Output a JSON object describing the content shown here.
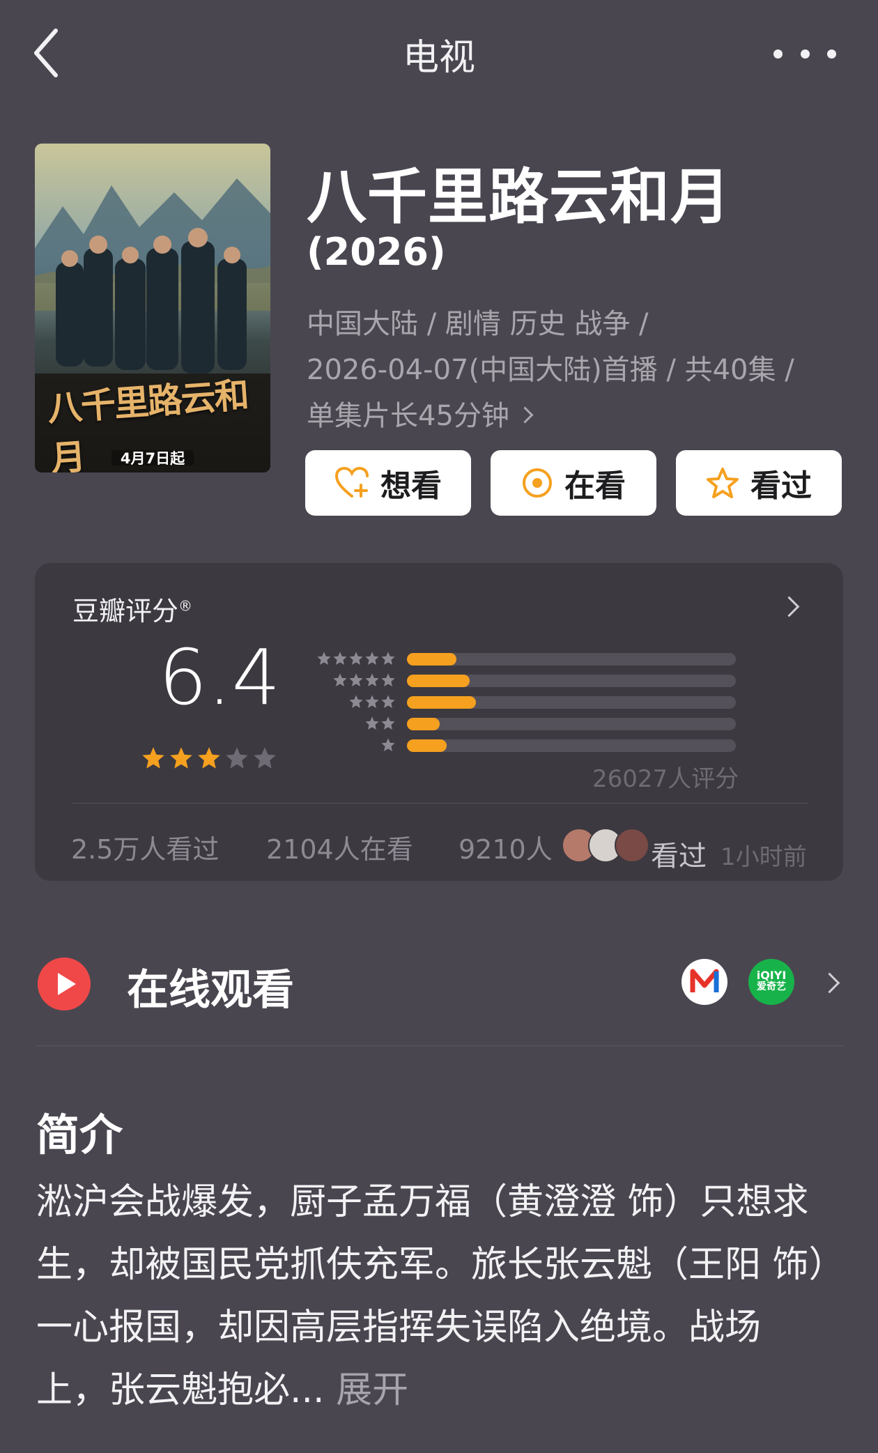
{
  "header": {
    "title": "电视",
    "back_icon": "back-arrow-icon",
    "more_icon": "more-dots-icon"
  },
  "poster": {
    "title_art": "八千里路云和月",
    "date_text": "4月7日起"
  },
  "show": {
    "title": "八千里路云和月",
    "year": "(2026)",
    "meta_line1": "中国大陆 / 剧情 历史 战争 /",
    "meta_line2": "2026-04-07(中国大陆)首播 / 共40集 /",
    "meta_line3": "单集片长45分钟"
  },
  "actions": [
    {
      "label": "想看",
      "icon": "heart-plus-icon"
    },
    {
      "label": "在看",
      "icon": "target-circle-icon"
    },
    {
      "label": "看过",
      "icon": "star-outline-icon"
    }
  ],
  "rating": {
    "label": "豆瓣评分",
    "mark": "®",
    "score": "6.4",
    "stars_filled": 3,
    "stars_total": 5,
    "distribution": [
      {
        "stars": 5,
        "fraction": 0.15
      },
      {
        "stars": 4,
        "fraction": 0.19
      },
      {
        "stars": 3,
        "fraction": 0.21
      },
      {
        "stars": 2,
        "fraction": 0.1
      },
      {
        "stars": 1,
        "fraction": 0.12
      }
    ],
    "count_text": "26027人评分",
    "accent_color": "#f5a01f"
  },
  "stats": {
    "watched": "2.5万人看过",
    "watching": "2104人在看",
    "wish": "9210人",
    "recent_action": "看过",
    "recent_time": "1小时前"
  },
  "online": {
    "label": "在线观看",
    "platforms": [
      {
        "name": "mgtv",
        "icon": "mgtv-logo-icon"
      },
      {
        "name": "iqiyi",
        "logo_line1": "iQIYI",
        "logo_line2": "爱奇艺"
      }
    ]
  },
  "synopsis": {
    "title": "简介",
    "body": "淞沪会战爆发，厨子孟万福（黄澄澄 饰）只想求生，却被国民党抓伕充军。旅长张云魁（王阳 饰）一心报国，却因高层指挥失误陷入绝境。战场上，张云魁抱必...",
    "expand": "展开"
  }
}
